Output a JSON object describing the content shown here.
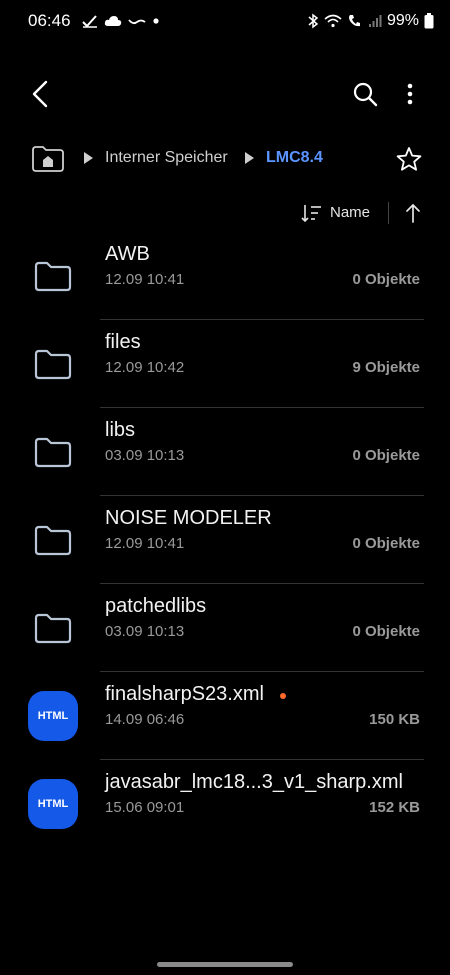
{
  "status_bar": {
    "time": "06:46",
    "battery_text": "99%",
    "left_icons": [
      "check-icon",
      "cloud-icon",
      "cloud-off-icon",
      "dot-icon"
    ],
    "right_icons": [
      "bluetooth-icon",
      "wifi-icon",
      "wifi-call-icon",
      "signal-icon",
      "battery-icon"
    ]
  },
  "toolbar": {
    "back_icon": "chevron-left-icon",
    "search_icon": "search-icon",
    "more_icon": "more-vert-icon"
  },
  "breadcrumb": {
    "home_icon": "home-icon",
    "items": [
      {
        "label": "Interner Speicher"
      },
      {
        "label": "LMC8.4"
      }
    ],
    "active_color": "#5b95ff",
    "favorite_icon": "star-outline-icon"
  },
  "sort": {
    "label": "Name",
    "icon": "sort-icon",
    "direction_icon": "arrow-up-icon"
  },
  "files": [
    {
      "name": "AWB",
      "date": "12.09 10:41",
      "meta": "0 Objekte",
      "type": "folder",
      "is_new": false
    },
    {
      "name": "files",
      "date": "12.09 10:42",
      "meta": "9 Objekte",
      "type": "folder",
      "is_new": false
    },
    {
      "name": "libs",
      "date": "03.09 10:13",
      "meta": "0 Objekte",
      "type": "folder",
      "is_new": false
    },
    {
      "name": "NOISE MODELER",
      "date": "12.09 10:41",
      "meta": "0 Objekte",
      "type": "folder",
      "is_new": false
    },
    {
      "name": "patchedlibs",
      "date": "03.09 10:13",
      "meta": "0 Objekte",
      "type": "folder",
      "is_new": false
    },
    {
      "name": "finalsharpS23.xml",
      "date": "14.09 06:46",
      "meta": "150 KB",
      "type": "html",
      "badge": "HTML",
      "is_new": true
    },
    {
      "name": "javasabr_lmc18...3_v1_sharp.xml",
      "date": "15.06 09:01",
      "meta": "152 KB",
      "type": "html",
      "badge": "HTML",
      "is_new": false
    }
  ],
  "colors": {
    "background": "#000000",
    "accent": "#5b95ff",
    "html_badge": "#1559e8",
    "new_dot": "#ff6a2b"
  }
}
